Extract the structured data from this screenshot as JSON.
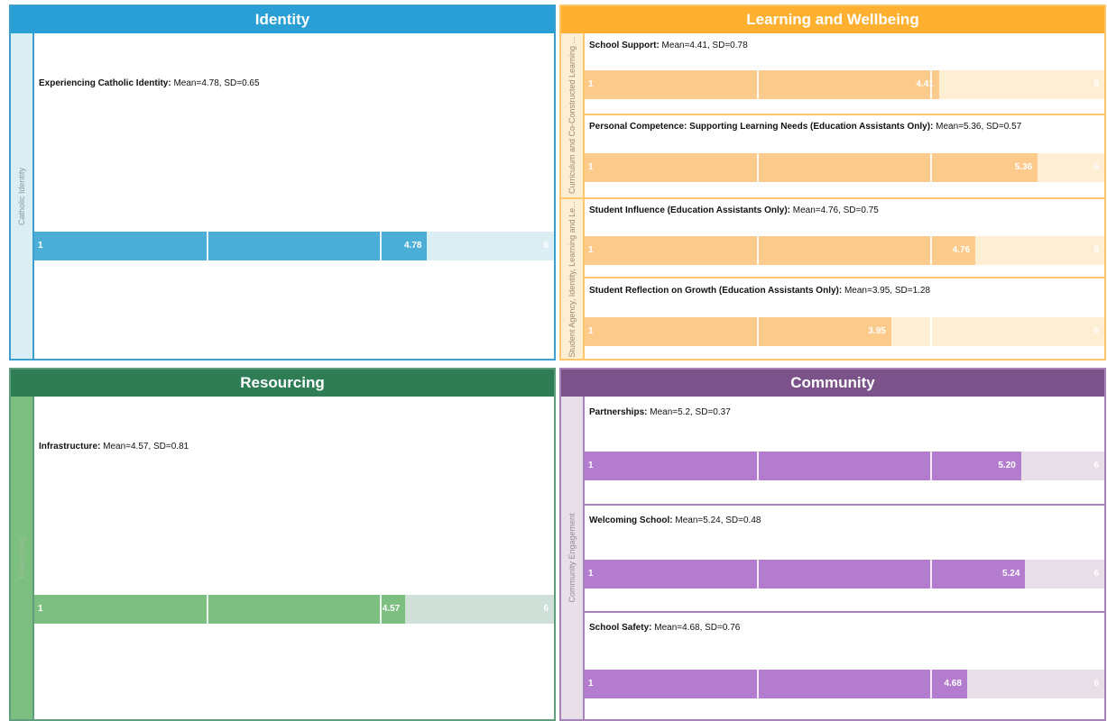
{
  "scale": {
    "min_label": "1",
    "max_label": "6",
    "min": 1,
    "max": 6
  },
  "panels": {
    "identity": {
      "title": "Identity",
      "colors": {
        "header": "#2a9fd6",
        "border": "#3a9fd1",
        "side": "#dbeef4",
        "side_text": "#8a98a0",
        "fill": "#4aaed6",
        "track": "#dbeef4"
      },
      "groups": [
        {
          "label": "Catholic Identity"
        }
      ],
      "items": [
        {
          "name": "Experiencing Catholic Identity:",
          "stats": " Mean=4.78, SD=0.65",
          "value": 4.78,
          "value_label": "4.78"
        }
      ]
    },
    "learning": {
      "title": "Learning and Wellbeing",
      "colors": {
        "header": "#ffb030",
        "border": "#ffc76a",
        "side": "#fdeed4",
        "side_text": "#9a8a70",
        "fill": "#fccb8c",
        "track": "#fdeed4"
      },
      "groups": [
        {
          "label": "Curriculum and Co-Constructed Learning ..."
        },
        {
          "label": "Student Agency, Identity, Learning and Le..."
        }
      ],
      "items": [
        {
          "name": "School Support:",
          "stats": " Mean=4.41, SD=0.78",
          "value": 4.41,
          "value_label": "4.41"
        },
        {
          "name": "Personal Competence: Supporting Learning Needs (Education Assistants Only):",
          "stats": " Mean=5.36, SD=0.57",
          "value": 5.36,
          "value_label": "5.36"
        },
        {
          "name": "Student Influence (Education Assistants Only):",
          "stats": " Mean=4.76, SD=0.75",
          "value": 4.76,
          "value_label": "4.76"
        },
        {
          "name": "Student Reflection on Growth (Education Assistants Only):",
          "stats": " Mean=3.95, SD=1.28",
          "value": 3.95,
          "value_label": "3.95"
        }
      ]
    },
    "resourcing": {
      "title": "Resourcing",
      "colors": {
        "header": "#2e7d55",
        "border": "#5f9e7d",
        "side": "#7cbf80",
        "side_text": "#9ac09a",
        "fill": "#7cbf80",
        "track": "#cfe0d8"
      },
      "groups": [
        {
          "label": "Resourcing"
        }
      ],
      "items": [
        {
          "name": "Infrastructure:",
          "stats": " Mean=4.57, SD=0.81",
          "value": 4.57,
          "value_label": "4.57"
        }
      ]
    },
    "community": {
      "title": "Community",
      "colors": {
        "header": "#7b528a",
        "border": "#a784b8",
        "side": "#e8dfe8",
        "side_text": "#9a8aa0",
        "fill": "#b47ccf",
        "track": "#e8dfe8"
      },
      "groups": [
        {
          "label": "Community Engagement"
        }
      ],
      "items": [
        {
          "name": "Partnerships:",
          "stats": " Mean=5.2, SD=0.37",
          "value": 5.2,
          "value_label": "5.20"
        },
        {
          "name": "Welcoming School:",
          "stats": " Mean=5.24, SD=0.48",
          "value": 5.24,
          "value_label": "5.24"
        },
        {
          "name": "School Safety:",
          "stats": " Mean=4.68, SD=0.76",
          "value": 4.68,
          "value_label": "4.68"
        }
      ]
    }
  },
  "chart_data": {
    "type": "bar",
    "orientation": "horizontal",
    "xlim": [
      1,
      6
    ],
    "categories": [
      "Experiencing Catholic Identity",
      "School Support",
      "Personal Competence: Supporting Learning Needs (Education Assistants Only)",
      "Student Influence (Education Assistants Only)",
      "Student Reflection on Growth (Education Assistants Only)",
      "Infrastructure",
      "Partnerships",
      "Welcoming School",
      "School Safety"
    ],
    "values": [
      4.78,
      4.41,
      5.36,
      4.76,
      3.95,
      4.57,
      5.2,
      5.24,
      4.68
    ],
    "sd": [
      0.65,
      0.78,
      0.57,
      0.75,
      1.28,
      0.81,
      0.37,
      0.48,
      0.76
    ],
    "panels": [
      "Identity",
      "Learning and Wellbeing",
      "Learning and Wellbeing",
      "Learning and Wellbeing",
      "Learning and Wellbeing",
      "Resourcing",
      "Community",
      "Community",
      "Community"
    ],
    "grid": false
  }
}
